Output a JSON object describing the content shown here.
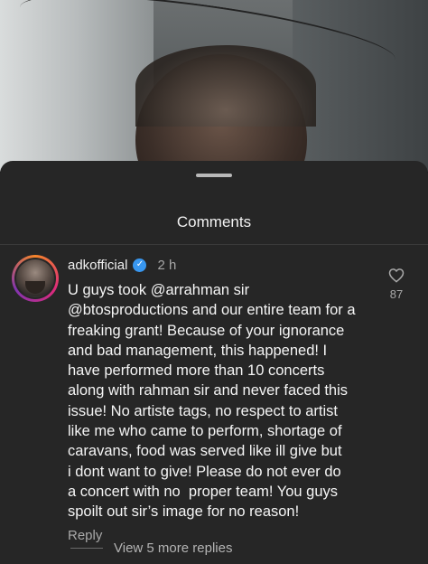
{
  "sheet": {
    "title": "Comments"
  },
  "comment": {
    "username": "adkofficial",
    "verified_icon": "verified-badge-icon",
    "time": "2 h",
    "text": "U guys took @arrahman sir\n@btosproductions and our entire team for a\nfreaking grant! Because of your ignorance\nand bad management, this happened! I\nhave performed more than 10 concerts\nalong with rahman sir and never faced this\nissue! No artiste tags, no respect to artist\nlike me who came to perform, shortage of\ncaravans, food was served like ill give but\ni dont want to give! Please do not ever do\na concert with no  proper team! You guys\nspoilt out sir’s image for no reason!",
    "reply_label": "Reply",
    "like_count": "87"
  },
  "view_replies": "View 5 more replies",
  "colors": {
    "sheet_bg": "#262626",
    "verified": "#3897f0",
    "text": "#f5f5f5",
    "muted": "#a8a8a8"
  }
}
